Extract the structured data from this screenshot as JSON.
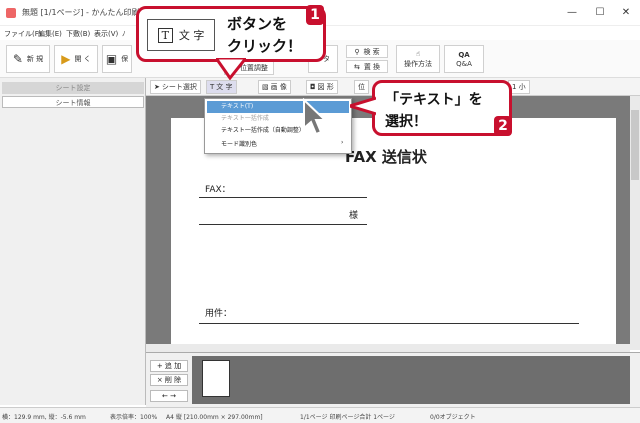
{
  "window": {
    "title": "無題 [1/1ページ] - かんたん印刷位置合わ",
    "minimize": "—",
    "maximize": "☐",
    "close": "✕"
  },
  "menu": [
    "ファイル(F)",
    "編集(E)",
    "下敷(B)",
    "表示(V)",
    "ﾉ"
  ],
  "toolbar": {
    "new": "新 規",
    "open": "開 く",
    "save_partial": "保",
    "position_adjust": "位置調整",
    "data_partial": "ータ",
    "search": "検 索",
    "replace": "置 換",
    "operation": "操作方法",
    "qa": "Q&A"
  },
  "left_panel": {
    "sheet_settings": "シート設定",
    "sheet_info": "シート情報"
  },
  "sub_toolbar": {
    "sheet_select": "シート選択",
    "text": "文 字",
    "image": "画 像",
    "shape": "図 形",
    "position_partial": "位",
    "small": "1 小"
  },
  "dropdown": {
    "items": [
      "テキスト(T)",
      "テキスト一括作成",
      "テキスト一括作成（自動調整）",
      "モード識別色"
    ]
  },
  "document": {
    "title": "FAX 送信状",
    "fax_label": "FAX：",
    "sama": "様",
    "subject_label": "用件："
  },
  "bottom": {
    "add": "+ 追 加",
    "delete": "× 削 除",
    "nav": "←  →"
  },
  "status": {
    "coords": "横：129.9 mm, 縦：-5.6 mm",
    "zoom": "表示倍率：100%",
    "paper": "A4 縦 [210.00mm × 297.00mm]",
    "pages": "1/1ページ 印刷ページ合計 1ページ",
    "objects": "0/0オブジェクト"
  },
  "callout1": {
    "button_icon": "T",
    "button_label": "文 字",
    "line1": "ボタンを",
    "line2": "クリック！",
    "badge": "1"
  },
  "callout2": {
    "line1": "「テキスト」を",
    "line2": "選択！",
    "badge": "2"
  },
  "colors": {
    "accent_red": "#c8102e",
    "highlight_blue": "#5b9bd5"
  }
}
